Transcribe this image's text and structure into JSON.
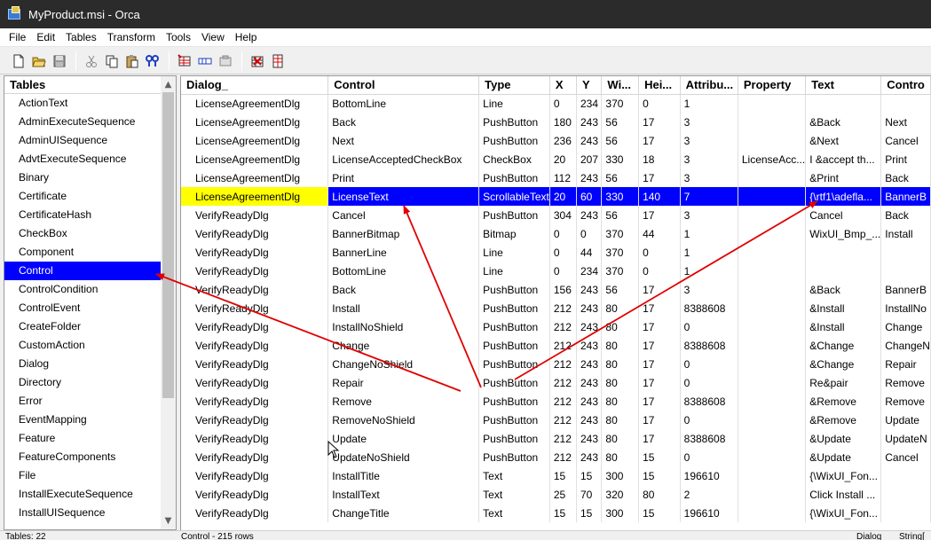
{
  "window": {
    "title": "MyProduct.msi - Orca"
  },
  "menu": [
    "File",
    "Edit",
    "Tables",
    "Transform",
    "Tools",
    "View",
    "Help"
  ],
  "toolbar": {
    "icons": [
      "new-file-icon",
      "open-folder-icon",
      "save-icon",
      "cut-icon",
      "copy-icon",
      "paste-icon",
      "find-icon",
      "add-table-icon",
      "add-row-icon",
      "drop-table-icon",
      "validate-icon",
      "merge-module-icon"
    ]
  },
  "tables_panel": {
    "header": "Tables",
    "selected": "Control",
    "items": [
      "ActionText",
      "AdminExecuteSequence",
      "AdminUISequence",
      "AdvtExecuteSequence",
      "Binary",
      "Certificate",
      "CertificateHash",
      "CheckBox",
      "Component",
      "Control",
      "ControlCondition",
      "ControlEvent",
      "CreateFolder",
      "CustomAction",
      "Dialog",
      "Directory",
      "Error",
      "EventMapping",
      "Feature",
      "FeatureComponents",
      "File",
      "InstallExecuteSequence",
      "InstallUISequence"
    ]
  },
  "grid": {
    "columns": [
      "Dialog_",
      "Control",
      "Type",
      "X",
      "Y",
      "Wi...",
      "Hei...",
      "Attribu...",
      "Property",
      "Text",
      "Contro"
    ],
    "selected_row": 5,
    "rows": [
      [
        "LicenseAgreementDlg",
        "BottomLine",
        "Line",
        "0",
        "234",
        "370",
        "0",
        "1",
        "",
        "",
        ""
      ],
      [
        "LicenseAgreementDlg",
        "Back",
        "PushButton",
        "180",
        "243",
        "56",
        "17",
        "3",
        "",
        "&Back",
        "Next"
      ],
      [
        "LicenseAgreementDlg",
        "Next",
        "PushButton",
        "236",
        "243",
        "56",
        "17",
        "3",
        "",
        "&Next",
        "Cancel"
      ],
      [
        "LicenseAgreementDlg",
        "LicenseAcceptedCheckBox",
        "CheckBox",
        "20",
        "207",
        "330",
        "18",
        "3",
        "LicenseAcc...",
        "I &accept th...",
        "Print"
      ],
      [
        "LicenseAgreementDlg",
        "Print",
        "PushButton",
        "112",
        "243",
        "56",
        "17",
        "3",
        "",
        "&Print",
        "Back"
      ],
      [
        "LicenseAgreementDlg",
        "LicenseText",
        "ScrollableText",
        "20",
        "60",
        "330",
        "140",
        "7",
        "",
        "{\\rtf1\\adefla...",
        "BannerB"
      ],
      [
        "VerifyReadyDlg",
        "Cancel",
        "PushButton",
        "304",
        "243",
        "56",
        "17",
        "3",
        "",
        "Cancel",
        "Back"
      ],
      [
        "VerifyReadyDlg",
        "BannerBitmap",
        "Bitmap",
        "0",
        "0",
        "370",
        "44",
        "1",
        "",
        "WixUI_Bmp_...",
        "Install"
      ],
      [
        "VerifyReadyDlg",
        "BannerLine",
        "Line",
        "0",
        "44",
        "370",
        "0",
        "1",
        "",
        "",
        ""
      ],
      [
        "VerifyReadyDlg",
        "BottomLine",
        "Line",
        "0",
        "234",
        "370",
        "0",
        "1",
        "",
        "",
        ""
      ],
      [
        "VerifyReadyDlg",
        "Back",
        "PushButton",
        "156",
        "243",
        "56",
        "17",
        "3",
        "",
        "&Back",
        "BannerB"
      ],
      [
        "VerifyReadyDlg",
        "Install",
        "PushButton",
        "212",
        "243",
        "80",
        "17",
        "8388608",
        "",
        "&Install",
        "InstallNo"
      ],
      [
        "VerifyReadyDlg",
        "InstallNoShield",
        "PushButton",
        "212",
        "243",
        "80",
        "17",
        "0",
        "",
        "&Install",
        "Change"
      ],
      [
        "VerifyReadyDlg",
        "Change",
        "PushButton",
        "212",
        "243",
        "80",
        "17",
        "8388608",
        "",
        "&Change",
        "ChangeN"
      ],
      [
        "VerifyReadyDlg",
        "ChangeNoShield",
        "PushButton",
        "212",
        "243",
        "80",
        "17",
        "0",
        "",
        "&Change",
        "Repair"
      ],
      [
        "VerifyReadyDlg",
        "Repair",
        "PushButton",
        "212",
        "243",
        "80",
        "17",
        "0",
        "",
        "Re&pair",
        "Remove"
      ],
      [
        "VerifyReadyDlg",
        "Remove",
        "PushButton",
        "212",
        "243",
        "80",
        "17",
        "8388608",
        "",
        "&Remove",
        "Remove"
      ],
      [
        "VerifyReadyDlg",
        "RemoveNoShield",
        "PushButton",
        "212",
        "243",
        "80",
        "17",
        "0",
        "",
        "&Remove",
        "Update"
      ],
      [
        "VerifyReadyDlg",
        "Update",
        "PushButton",
        "212",
        "243",
        "80",
        "17",
        "8388608",
        "",
        "&Update",
        "UpdateN"
      ],
      [
        "VerifyReadyDlg",
        "UpdateNoShield",
        "PushButton",
        "212",
        "243",
        "80",
        "15",
        "0",
        "",
        "&Update",
        "Cancel"
      ],
      [
        "VerifyReadyDlg",
        "InstallTitle",
        "Text",
        "15",
        "15",
        "300",
        "15",
        "196610",
        "",
        "{\\WixUI_Fon...",
        ""
      ],
      [
        "VerifyReadyDlg",
        "InstallText",
        "Text",
        "25",
        "70",
        "320",
        "80",
        "2",
        "",
        "Click Install ...",
        ""
      ],
      [
        "VerifyReadyDlg",
        "ChangeTitle",
        "Text",
        "15",
        "15",
        "300",
        "15",
        "196610",
        "",
        "{\\WixUI_Fon...",
        ""
      ]
    ]
  },
  "status": {
    "tables": "Tables: 22",
    "rows": "Control - 215 rows",
    "col_name": "Dialog_",
    "col_type": "String["
  },
  "colors": {
    "selection": "#0000ff",
    "highlight_cell": "#ffff00",
    "arrow": "#e00000",
    "titlebar": "#2b2b2b"
  }
}
